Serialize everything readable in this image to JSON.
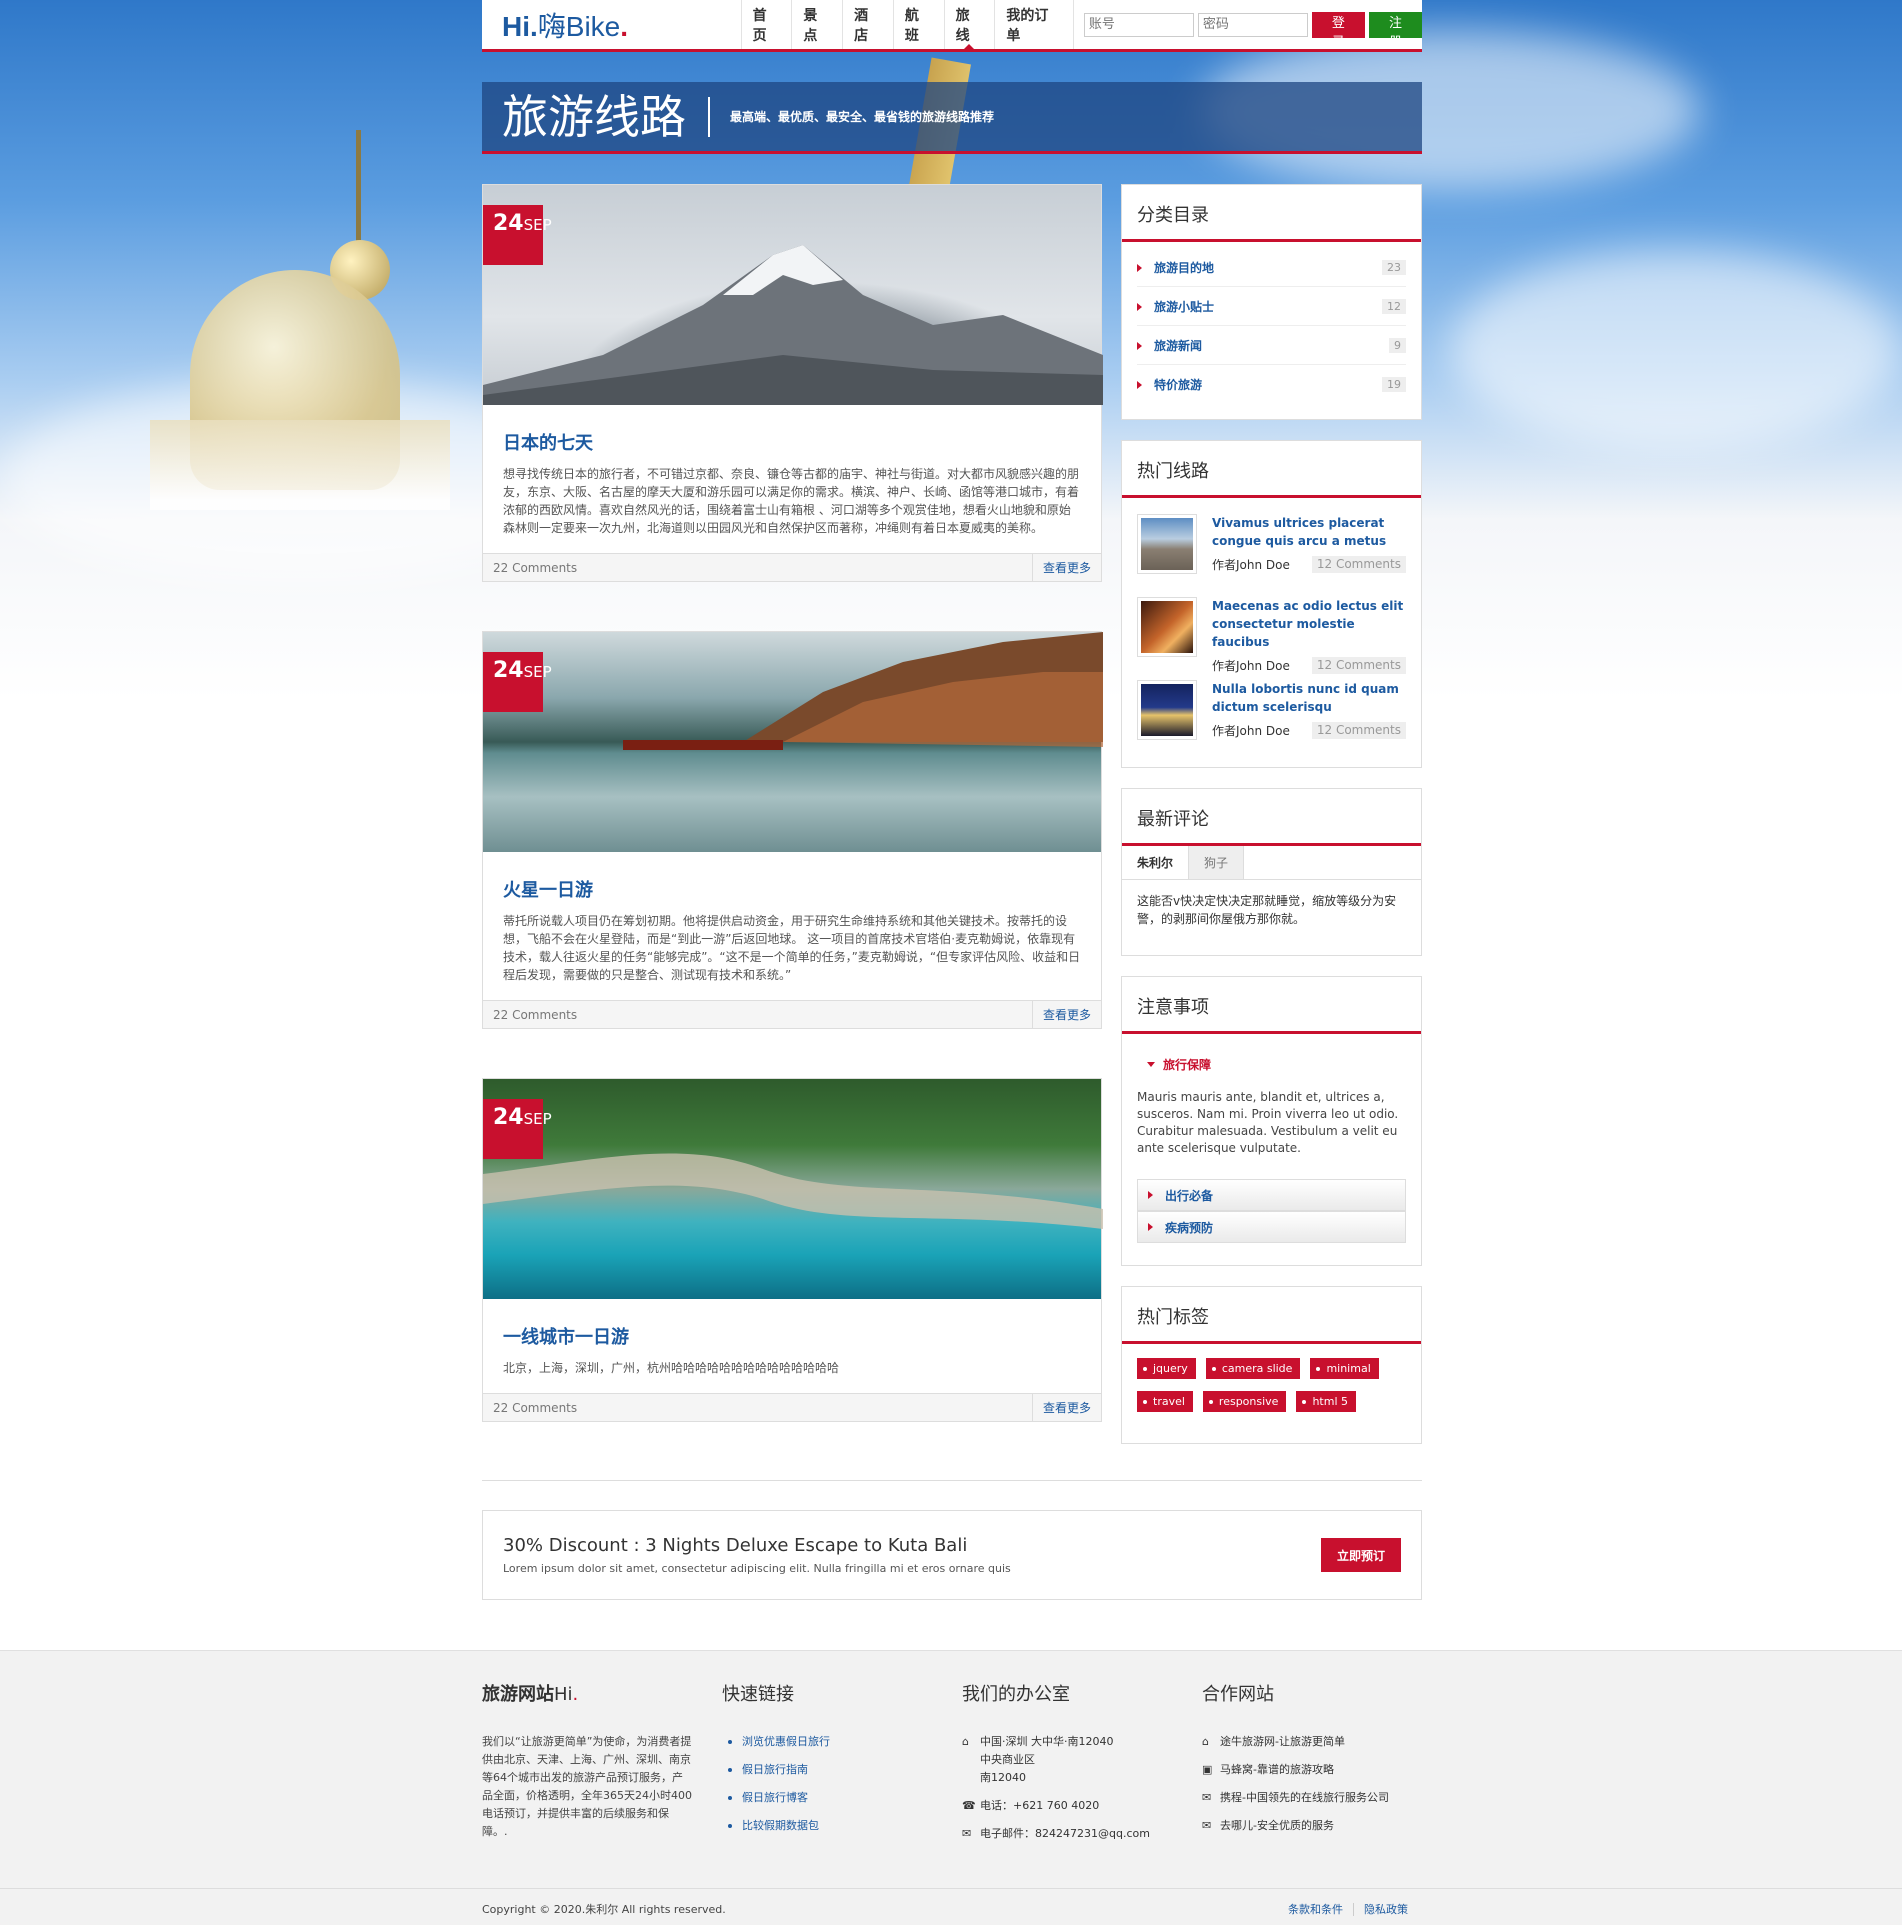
{
  "header": {
    "logo_prefix": "Hi.",
    "logo_text": "嗨Bike",
    "logo_dot": ".",
    "nav": [
      "首页",
      "景点",
      "酒店",
      "航班",
      "旅线",
      "我的订单"
    ],
    "account_placeholder": "账号",
    "password_placeholder": "密码",
    "login": "登录",
    "register": "注册"
  },
  "banner": {
    "title": "旅游线路",
    "subtitle": "最高端、最优质、最安全、最省钱的旅游线路推荐"
  },
  "posts": [
    {
      "day": "24",
      "month": "SEP",
      "title": "日本的七天",
      "body": "想寻找传统日本的旅行者，不可错过京都、奈良、镰仓等古都的庙宇、神社与街道。对大都市风貌感兴趣的朋友，东京、大阪、名古屋的摩天大厦和游乐园可以满足你的需求。横滨、神户、长崎、函馆等港口城市，有着浓郁的西欧风情。喜欢自然风光的话，围绕着富士山有箱根 、河口湖等多个观赏佳地，想看火山地貌和原始森林则一定要来一次九州，北海道则以田园风光和自然保护区而著称，冲绳则有着日本夏威夷的美称。",
      "comments": "22 Comments",
      "more": "查看更多"
    },
    {
      "day": "24",
      "month": "SEP",
      "title": "火星一日游",
      "body": "蒂托所说载人项目仍在筹划初期。他将提供启动资金，用于研究生命维持系统和其他关键技术。按蒂托的设想，飞船不会在火星登陆，而是“到此一游”后返回地球。 这一项目的首席技术官塔伯·麦克勒姆说，依靠现有技术，载人往返火星的任务“能够完成”。“这不是一个简单的任务，”麦克勒姆说，“但专家评估风险、收益和日程后发现，需要做的只是整合、测试现有技术和系统。”",
      "comments": "22 Comments",
      "more": "查看更多"
    },
    {
      "day": "24",
      "month": "SEP",
      "title": "一线城市一日游",
      "body": "北京，上海，深圳，广州，杭州哈哈哈哈哈哈哈哈哈哈哈哈哈哈",
      "comments": "22 Comments",
      "more": "查看更多"
    }
  ],
  "sidebar": {
    "categories": {
      "title": "分类目录",
      "items": [
        {
          "label": "旅游目的地",
          "count": "23"
        },
        {
          "label": "旅游小贴士",
          "count": "12"
        },
        {
          "label": "旅游新闻",
          "count": "9"
        },
        {
          "label": "特价旅游",
          "count": "19"
        }
      ]
    },
    "hot": {
      "title": "热门线路",
      "items": [
        {
          "title": "Vivamus ultrices placerat congue quis arcu a metus",
          "author": "作者John Doe",
          "comments": "12 Comments"
        },
        {
          "title": "Maecenas ac odio lectus elit consectetur molestie faucibus",
          "author": "作者John Doe",
          "comments": "12 Comments"
        },
        {
          "title": "Nulla lobortis nunc id quam dictum scelerisqu",
          "author": "作者John Doe",
          "comments": "12 Comments"
        }
      ]
    },
    "comments": {
      "title": "最新评论",
      "tabs": [
        "朱利尔",
        "狗子"
      ],
      "text": "这能否v快决定快决定那就睡觉，缩放等级分为安警，的剥那间你屋俄方那你就。"
    },
    "notes": {
      "title": "注意事项",
      "open": "旅行保障",
      "open_text": "Mauris mauris ante, blandit et, ultrices a, susceros. Nam mi. Proin viverra leo ut odio. Curabitur malesuada. Vestibulum a velit eu ante scelerisque vulputate.",
      "closed": [
        "出行必备",
        "疾病预防"
      ]
    },
    "tags": {
      "title": "热门标签",
      "items": [
        "jquery",
        "camera slide",
        "minimal",
        "travel",
        "responsive",
        "html 5"
      ]
    }
  },
  "promo": {
    "title": "30% Discount : 3 Nights Deluxe Escape to Kuta Bali",
    "text": "Lorem ipsum dolor sit amet, consectetur adipiscing elit. Nulla fringilla mi et eros ornare quis",
    "button": "立即预订"
  },
  "footer": {
    "logo_bold": "旅游网站",
    "logo_light": "Hi",
    "logo_dot": ".",
    "about": "我们以“让旅游更简单”为使命，为消费者提供由北京、天津、上海、广州、深圳、南京等64个城市出发的旅游产品预订服务，产品全面，价格透明，全年365天24小时400电话预订，并提供丰富的后续服务和保障。.",
    "links_title": "快速链接",
    "links": [
      "浏览优惠假日旅行",
      "假日旅行指南",
      "假日旅行博客",
      "比较假期数据包"
    ],
    "office_title": "我们的办公室",
    "address": [
      "中国·深圳 大中华·南12040",
      "中央商业区",
      "南12040"
    ],
    "phone": "电话：+621 760 4020",
    "email": "电子邮件：824247231@qq.com",
    "partners_title": "合作网站",
    "partners": [
      "途牛旅游网-让旅游更简单",
      "马蜂窝-靠谱的旅游攻略",
      "携程-中国领先的在线旅行服务公司",
      "去哪儿-安全优质的服务"
    ]
  },
  "copyright": {
    "text": "Copyright © 2020.朱利尔 All rights reserved.",
    "links": [
      "条款和条件",
      "隐私政策"
    ]
  }
}
